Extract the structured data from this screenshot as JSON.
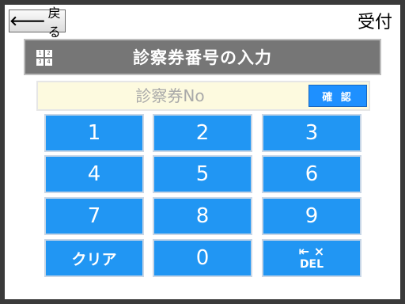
{
  "top": {
    "back_arrow": "🡐",
    "back_label": "戻る",
    "screen_title": "受付"
  },
  "header": {
    "title": "診察券番号の入力",
    "icon": "keypad-icon",
    "icon_digits": [
      "1",
      "2",
      "3",
      "4"
    ]
  },
  "input": {
    "placeholder": "診察券No",
    "confirm_label": "確 認"
  },
  "keypad": {
    "keys": [
      "1",
      "2",
      "3",
      "4",
      "5",
      "6",
      "7",
      "8",
      "9"
    ],
    "clear_label": "クリア",
    "zero_label": "0",
    "del_symbol": "⇤ ×",
    "del_label": "DEL"
  },
  "colors": {
    "key_blue": "#2196f3",
    "header_gray": "#767676",
    "input_bg": "#fdfadf"
  }
}
